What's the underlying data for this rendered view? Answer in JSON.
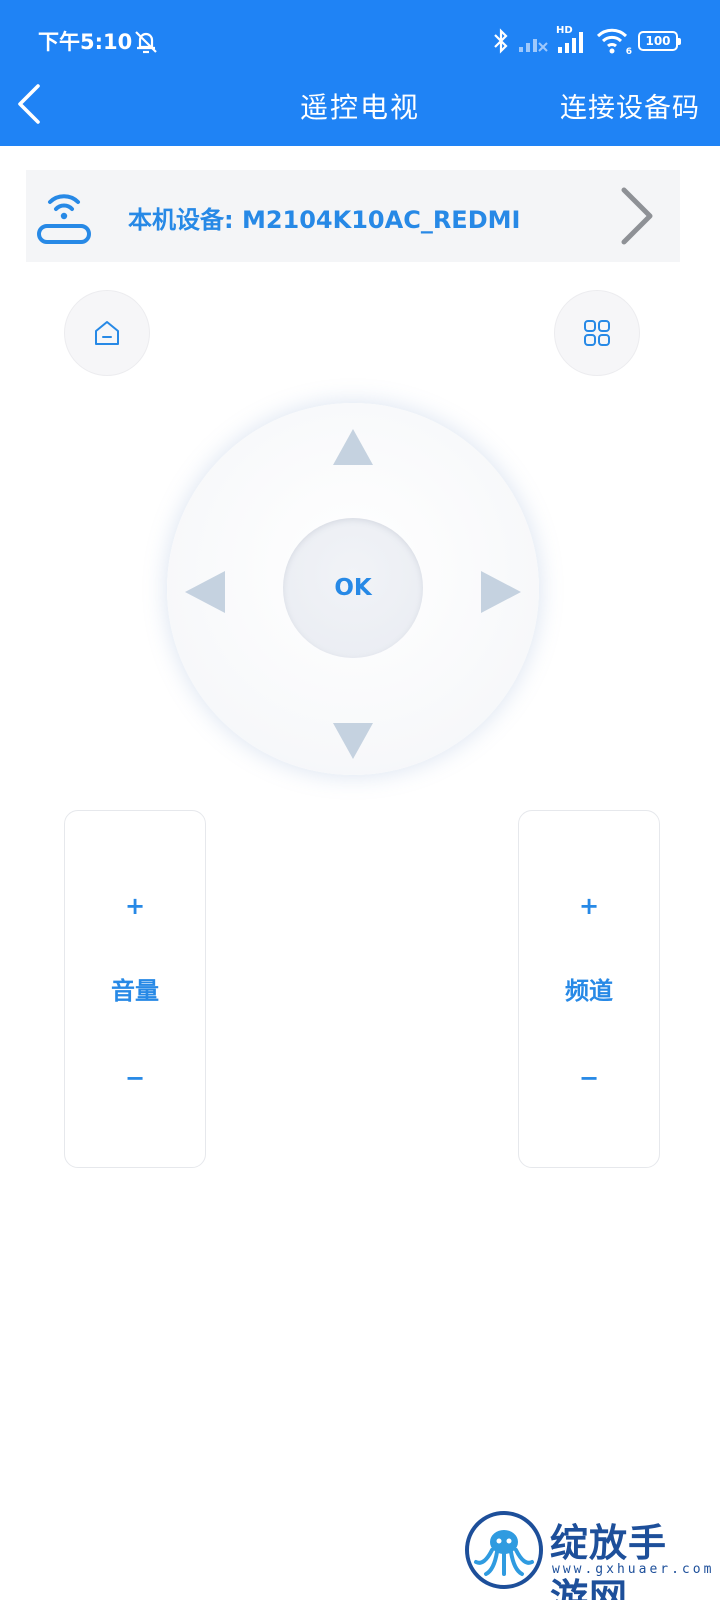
{
  "status_bar": {
    "time": "下午5:10",
    "signal_hd": "HD",
    "wifi_badge": "6",
    "battery": "100"
  },
  "nav": {
    "title": "遥控电视",
    "action": "连接设备码"
  },
  "device": {
    "label": "本机设备: M2104K10AC_REDMI"
  },
  "dpad": {
    "ok_label": "OK"
  },
  "volume": {
    "plus": "+",
    "label": "音量",
    "minus": "−"
  },
  "channel": {
    "plus": "+",
    "label": "频道",
    "minus": "−"
  },
  "watermark": {
    "text": "绽放手游网",
    "url": "www.gxhuaer.com"
  },
  "colors": {
    "header_bg": "#1f83f5",
    "accent": "#2789e6",
    "arrow": "#c5d2e0",
    "device_bar_bg": "#f4f5f7"
  }
}
